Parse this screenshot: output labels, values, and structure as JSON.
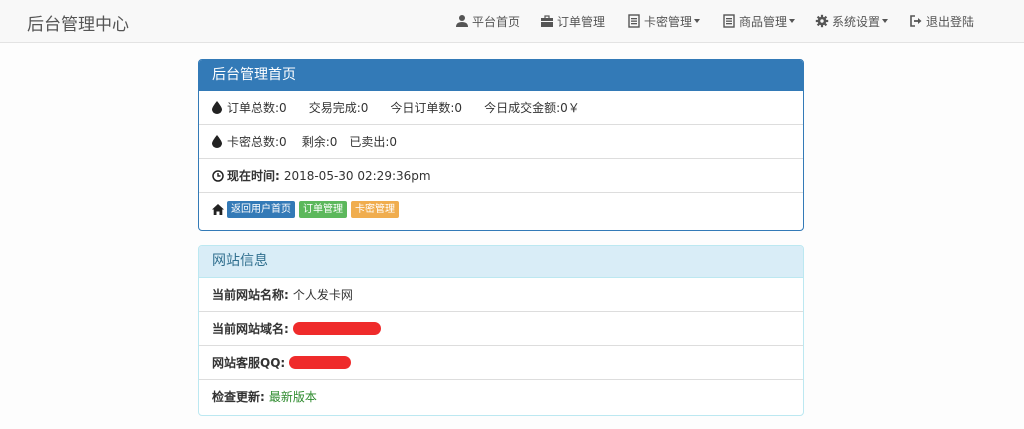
{
  "navbar": {
    "brand": "后台管理中心",
    "items": [
      {
        "label": "平台首页",
        "icon": "user-icon"
      },
      {
        "label": "订单管理",
        "icon": "briefcase-icon"
      },
      {
        "label": "卡密管理",
        "icon": "list-icon",
        "dropdown": true
      },
      {
        "label": "商品管理",
        "icon": "list-icon",
        "dropdown": true
      },
      {
        "label": "系统设置",
        "icon": "gear-icon",
        "dropdown": true
      },
      {
        "label": "退出登陆",
        "icon": "logout-icon"
      }
    ]
  },
  "admin_panel": {
    "title": "后台管理首页",
    "orders": {
      "total_label": "订单总数:0",
      "done_label": "交易完成:0",
      "today_label": "今日订单数:0",
      "amount_label": "今日成交金额:0￥"
    },
    "cards": {
      "total_label": "卡密总数:0",
      "left_label": "剩余:0",
      "sold_label": "已卖出:0"
    },
    "time": {
      "label": "现在时间:",
      "value": "2018-05-30 02:29:36pm"
    },
    "links": {
      "user_home": "返回用户首页",
      "orders": "订单管理",
      "cards": "卡密管理"
    }
  },
  "site_panel": {
    "title": "网站信息",
    "name_label": "当前网站名称:",
    "name_value": "个人发卡网",
    "domain_label": "当前网站域名:",
    "qq_label": "网站客服QQ:",
    "update_label": "检查更新:",
    "update_value": "最新版本"
  },
  "colors": {
    "primary": "#337ab7",
    "success": "#5cb85c",
    "warning": "#f0ad4e",
    "info_bg": "#d9edf7",
    "redaction": "#ef2b2b"
  }
}
